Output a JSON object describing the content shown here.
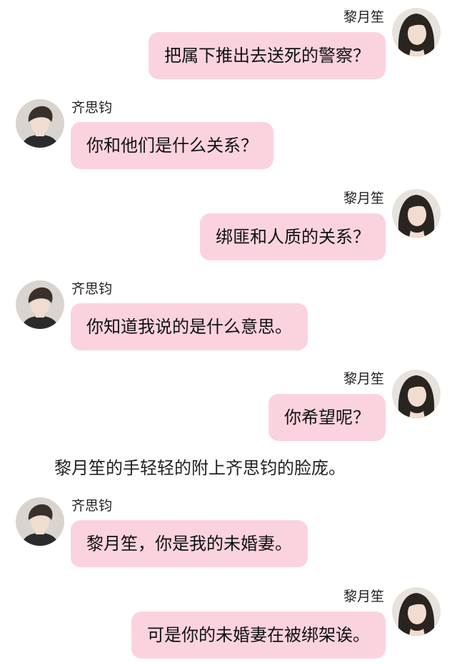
{
  "colors": {
    "bubble": "#fbd3df",
    "background": "#ffffff",
    "text": "#111111"
  },
  "messages": [
    {
      "side": "right",
      "name": "黎月笙",
      "text": "把属下推出去送死的警察？",
      "avatar": "female-avatar"
    },
    {
      "side": "left",
      "name": "齐思钧",
      "text": "你和他们是什么关系？",
      "avatar": "male-avatar"
    },
    {
      "side": "right",
      "name": "黎月笙",
      "text": "绑匪和人质的关系？",
      "avatar": "female-avatar"
    },
    {
      "side": "left",
      "name": "齐思钧",
      "text": "你知道我说的是什么意思。",
      "avatar": "male-avatar"
    },
    {
      "side": "right",
      "name": "黎月笙",
      "text": "你希望呢？",
      "avatar": "female-avatar"
    },
    {
      "side": "left",
      "name": "齐思钧",
      "text": "黎月笙，你是我的未婚妻。",
      "avatar": "male-avatar"
    },
    {
      "side": "right",
      "name": "黎月笙",
      "text": "可是你的未婚妻在被绑架诶。",
      "avatar": "female-avatar"
    }
  ],
  "narration": "黎月笙的手轻轻的附上齐思钧的脸庞。"
}
